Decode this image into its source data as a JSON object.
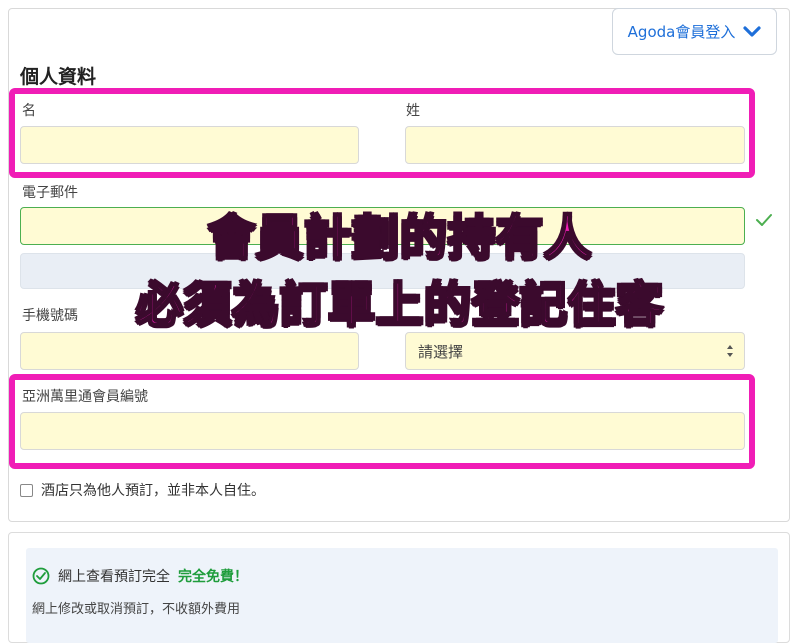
{
  "login_button": {
    "label": "Agoda會員登入"
  },
  "personal_info": {
    "title": "個人資料",
    "first_name_label": "名",
    "last_name_label": "姓",
    "email_label": "電子郵件",
    "phone_label": "手機號碼",
    "country_code_select": "請選擇",
    "membership_label": "亞洲萬里通會員編號"
  },
  "overlay": {
    "line1": "會員計劃的持有人",
    "line2": "必須為訂單上的登記住客"
  },
  "booking_for_other": {
    "label": "酒店只為他人預訂，並非本人自住。"
  },
  "benefits": {
    "line1_prefix": "網上查看預訂完全",
    "line1_free": "完全免費！",
    "line2": "網上修改或取消預訂，不收額外費用"
  },
  "colors": {
    "highlight": "#f01db6",
    "input_bg": "#fffbd4",
    "valid_green": "#4caf50",
    "link_blue": "#1e6fd9"
  },
  "icons": [
    "chevron-down-icon",
    "valid-check-icon",
    "select-arrows-icon",
    "check-circle-icon"
  ]
}
